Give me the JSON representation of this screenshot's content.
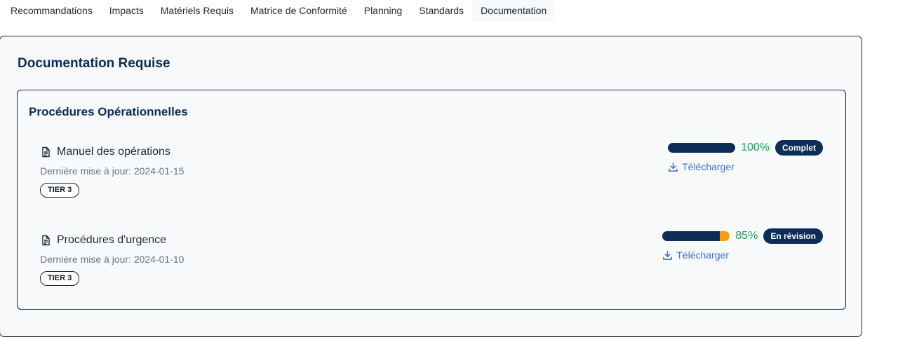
{
  "tabs": [
    {
      "label": "Recommandations"
    },
    {
      "label": "Impacts"
    },
    {
      "label": "Matériels Requis"
    },
    {
      "label": "Matrice de Conformité"
    },
    {
      "label": "Planning"
    },
    {
      "label": "Standards"
    },
    {
      "label": "Documentation",
      "active": true
    }
  ],
  "panel": {
    "title": "Documentation Requise"
  },
  "section": {
    "title": "Procédures Opérationnelles",
    "docs": [
      {
        "name": "Manuel des opérations",
        "updated": "Dernière mise à jour: 2024-01-15",
        "tier": "TIER 3",
        "progress_pct": "100%",
        "progress": 1.0,
        "status": "Complet",
        "download": "Télécharger",
        "icon": "document-icon"
      },
      {
        "name": "Procédures d'urgence",
        "updated": "Dernière mise à jour: 2024-01-10",
        "tier": "TIER 3",
        "progress_pct": "85%",
        "progress": 0.85,
        "status": "En révision",
        "download": "Télécharger",
        "icon": "document-icon"
      }
    ]
  },
  "colors": {
    "primary": "#0b2d57",
    "progress_remaining": "#f59e0b",
    "percent_text": "#22a35a",
    "link": "#3b6fd6"
  }
}
